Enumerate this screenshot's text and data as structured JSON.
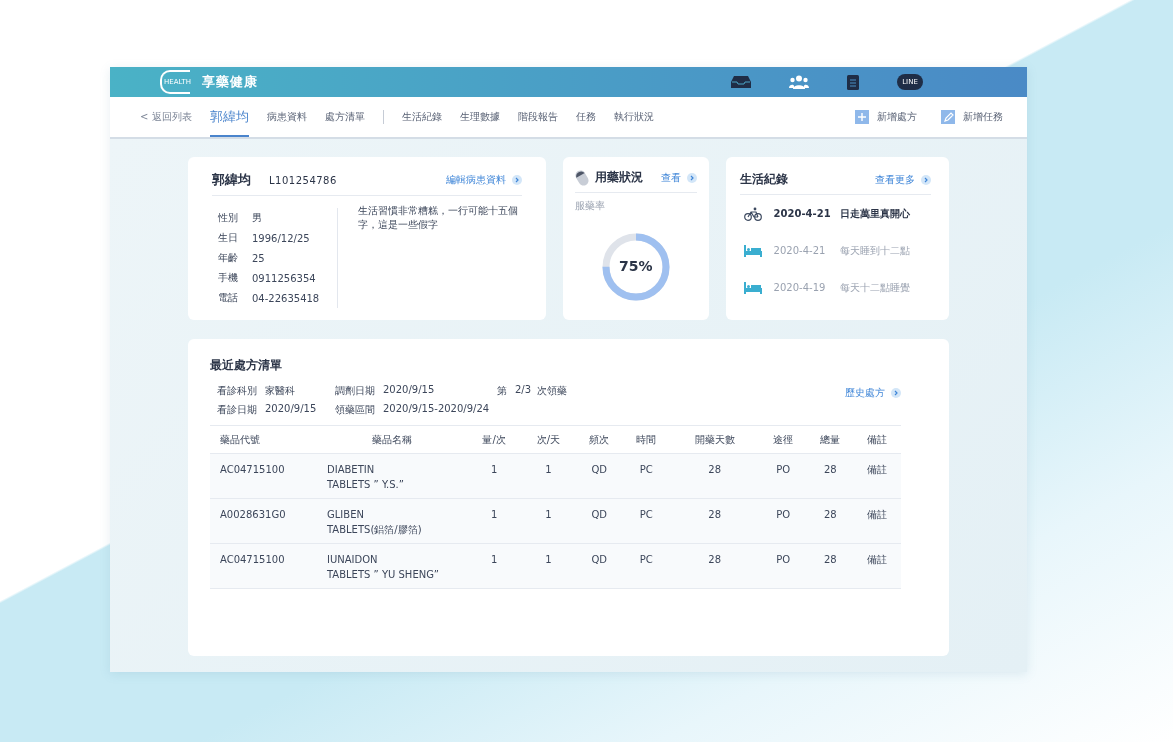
{
  "header": {
    "logo_text": "HEALTH",
    "title": "享藥健康",
    "icons": [
      {
        "kind": "inbox"
      },
      {
        "kind": "people"
      },
      {
        "kind": "clipboard"
      },
      {
        "kind": "chat",
        "label": "LINE"
      }
    ]
  },
  "nav": {
    "back": "< 返回列表",
    "patient_tabs": [
      {
        "label": "郭緯均",
        "selected": true
      },
      {
        "label": "病患資料",
        "selected": false
      },
      {
        "label": "處方清單",
        "selected": false
      }
    ],
    "record_tabs": [
      {
        "label": "生活紀錄",
        "selected": false
      },
      {
        "label": "生理數據",
        "selected": false
      },
      {
        "label": "階段報告",
        "selected": false
      },
      {
        "label": "任務",
        "selected": false
      },
      {
        "label": "執行狀況",
        "selected": false
      }
    ],
    "actions": [
      {
        "kind": "plus",
        "label": "新增處方"
      },
      {
        "kind": "edit",
        "label": "新增任務"
      }
    ]
  },
  "patient": {
    "name": "郭緯均",
    "id": "L101254786",
    "link": "編輯病患資料",
    "fields": [
      {
        "label": "性別",
        "value": "男"
      },
      {
        "label": "生日",
        "value": "1996/12/25"
      },
      {
        "label": "年齡",
        "value": "25"
      },
      {
        "label": "手機",
        "value": "0911256354"
      },
      {
        "label": "電話",
        "value": "04-22635418"
      }
    ],
    "note": "生活習慣非常糟糕，一行可能十五個字，這是一些假字"
  },
  "medication": {
    "title": "用藥狀況",
    "link": "查看",
    "metric_label": "服藥率",
    "reading": "75%",
    "level": 0.75
  },
  "life": {
    "title": "生活紀錄",
    "link": "查看更多",
    "entries": [
      {
        "kind": "bike",
        "date": "2020-4-21",
        "text": "日走萬里真開心",
        "emphasized": true
      },
      {
        "kind": "bed",
        "date": "2020-4-21",
        "text": "每天睡到十二點",
        "emphasized": false
      },
      {
        "kind": "bed",
        "date": "2020-4-19",
        "text": "每天十二點睡覺",
        "emphasized": false
      }
    ]
  },
  "prescription": {
    "title": "最近處方清單",
    "link": "歷史處方",
    "info": [
      {
        "label": "看診科別",
        "value": "家醫科"
      },
      {
        "label": "調劑日期",
        "value": "2020/9/15"
      },
      {
        "label": "第",
        "value": "2/3",
        "suffix": "次領藥"
      },
      {
        "label": "看診日期",
        "value": "2020/9/15"
      },
      {
        "label": "領藥區間",
        "value": "2020/9/15-2020/9/24"
      }
    ],
    "table": {
      "columns": [
        "藥品代號",
        "藥品名稱",
        "量/次",
        "次/天",
        "頻次",
        "時間",
        "開藥天數",
        "途徑",
        "總量",
        "備註"
      ],
      "rows": [
        [
          "AC04715100",
          "DIABETIN\nTABLETS ” Y.S.”",
          "1",
          "1",
          "QD",
          "PC",
          "28",
          "PO",
          "28",
          "備註"
        ],
        [
          "A0028631G0",
          "GLIBEN\nTABLETS(鋁箔/膠箔)",
          "1",
          "1",
          "QD",
          "PC",
          "28",
          "PO",
          "28",
          "備註"
        ],
        [
          "AC04715100",
          "IUNAIDON\nTABLETS ” YU SHENG”",
          "1",
          "1",
          "QD",
          "PC",
          "28",
          "PO",
          "28",
          "備註"
        ]
      ]
    }
  }
}
